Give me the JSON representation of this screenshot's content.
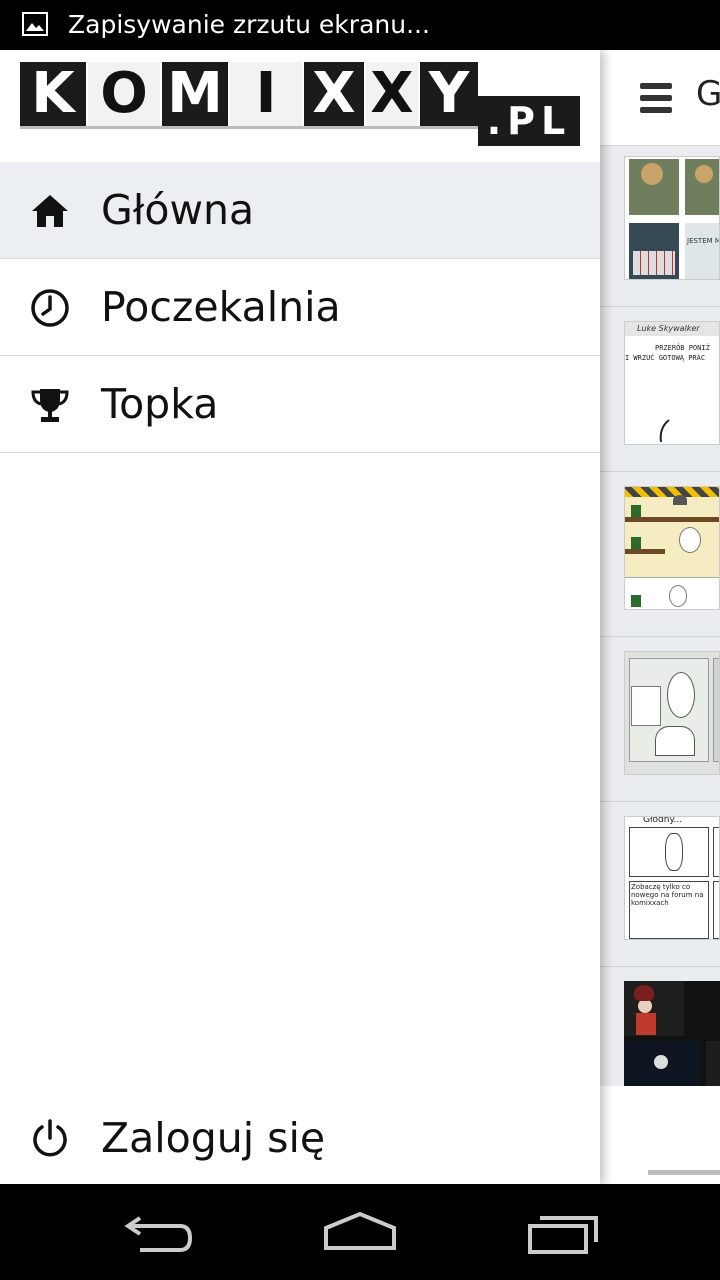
{
  "status_bar": {
    "notification_icon": "image-icon",
    "text": "Zapisywanie zrzutu ekranu..."
  },
  "logo": {
    "letters": [
      "K",
      "O",
      "M",
      "I",
      "X",
      "X",
      "Y"
    ],
    "suffix": ".PL"
  },
  "drawer": {
    "items": [
      {
        "label": "Główna",
        "icon": "home-icon",
        "active": true
      },
      {
        "label": "Poczekalnia",
        "icon": "clock-icon",
        "active": false
      },
      {
        "label": "Topka",
        "icon": "trophy-icon",
        "active": false
      }
    ],
    "login_label": "Zaloguj się",
    "login_icon": "power-icon"
  },
  "main": {
    "title_peek": "G",
    "menu_icon": "hamburger-icon",
    "comic_texts": {
      "c1_bubble": "JESTEM M",
      "c2_author": "Luke Skywalker",
      "c2_line1": "PRZERÓB PONIŻ",
      "c2_line2": "I WRZUĆ GOTOWĄ PRAC",
      "c5_header": "Głodny...",
      "c5_caption": "Zobaczę tylko co nowego na forum na komixxach"
    }
  },
  "navigation_bar": {
    "back": "back-icon",
    "home": "home-nav-icon",
    "recents": "recents-icon"
  },
  "colors": {
    "drawer_active_bg": "#eceff2",
    "status_bar_bg": "#000000",
    "list_bg": "#eaedf0"
  }
}
